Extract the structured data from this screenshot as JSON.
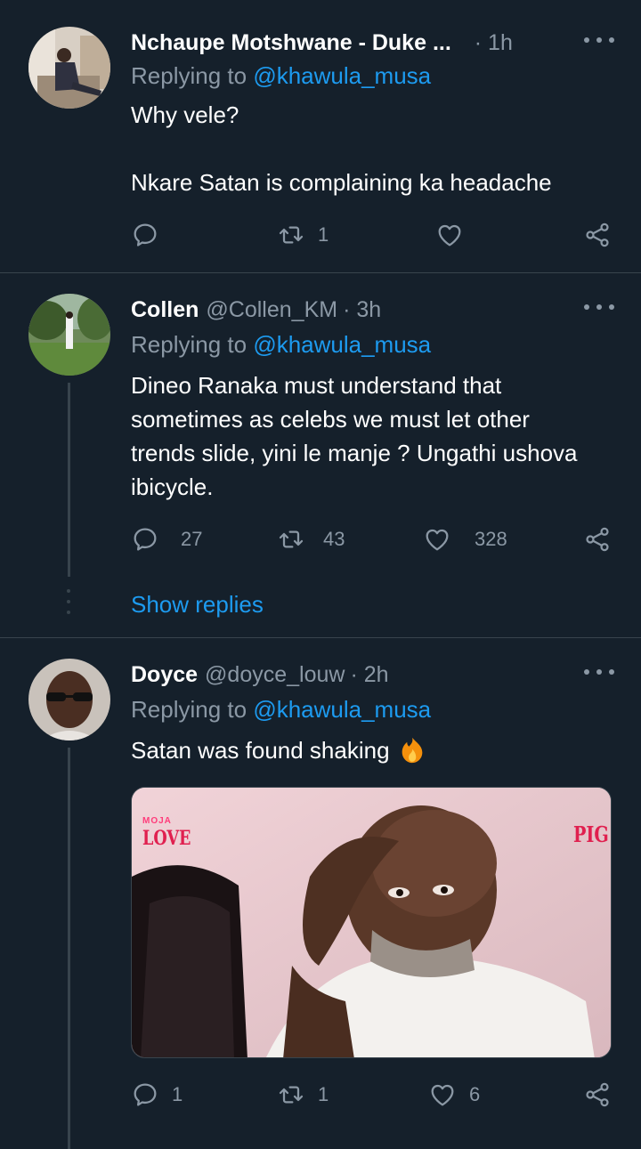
{
  "tweets": [
    {
      "name": "Nchaupe Motshwane - Duke ...",
      "handle": "",
      "time": "· 1h",
      "replying_prefix": "Replying to ",
      "replying_to": "@khawula_musa",
      "text": "Why vele?\n\nNkare Satan is complaining ka headache",
      "replies": "",
      "retweets": "1",
      "likes": ""
    },
    {
      "name": "Collen",
      "handle": "@Collen_KM",
      "time": "· 3h",
      "replying_prefix": "Replying to ",
      "replying_to": "@khawula_musa",
      "text": "Dineo Ranaka must understand that sometimes as celebs we must let other trends slide, yini le manje ? Ungathi ushova ibicycle.",
      "replies": "27",
      "retweets": "43",
      "likes": "328",
      "show_replies": "Show replies"
    },
    {
      "name": "Doyce",
      "handle": "@doyce_louw",
      "time": "· 2h",
      "replying_prefix": "Replying to ",
      "replying_to": "@khawula_musa",
      "text": "Satan was found shaking",
      "emoji": "fire-emoji",
      "media": {
        "logo_small": "MOJA",
        "logo": "LOVE",
        "corner_text": "PIG"
      },
      "replies": "1",
      "retweets": "1",
      "likes": "6"
    }
  ],
  "colors": {
    "background": "#15202b",
    "text": "#ffffff",
    "secondary": "#8b98a5",
    "link": "#1d9bf0",
    "divider": "#38444d"
  },
  "icons": [
    "reply-icon",
    "retweet-icon",
    "like-icon",
    "share-icon",
    "more-icon"
  ]
}
